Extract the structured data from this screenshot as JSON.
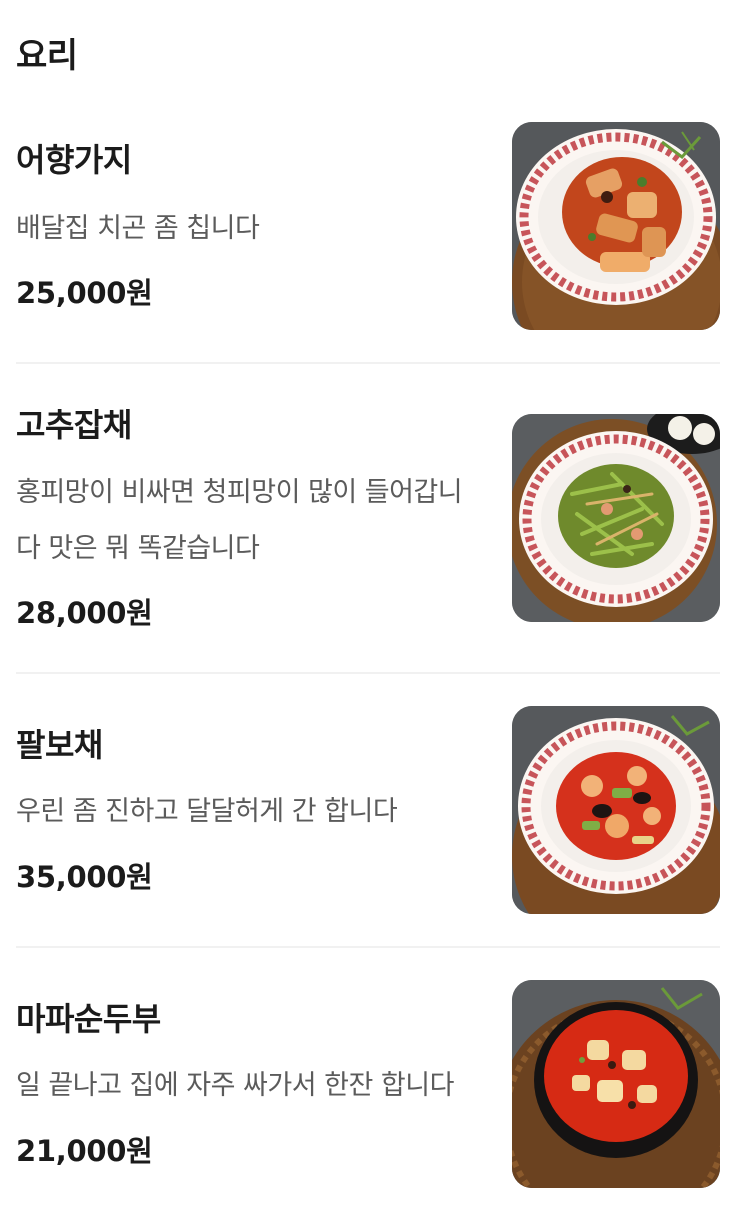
{
  "section": {
    "title": "요리"
  },
  "items": [
    {
      "name": "어향가지",
      "description": "배달집 치곤 좀 칩니다",
      "price": "25,000원",
      "photo": "braised-eggplant-dish-photo",
      "sauce_color": "#c2461c"
    },
    {
      "name": "고추잡채",
      "description": "홍피망이 비싸면 청피망이 많이 들어갑니다 맛은 뭐 똑같습니다",
      "price": "28,000원",
      "photo": "pepper-japchae-dish-photo",
      "sauce_color": "#6f8a2c"
    },
    {
      "name": "팔보채",
      "description": "우린 좀 진하고 달달허게 간 합니다",
      "price": "35,000원",
      "photo": "seafood-palbochae-dish-photo",
      "sauce_color": "#d5311c"
    },
    {
      "name": "마파순두부",
      "description": "일 끝나고 집에 자주 싸가서 한잔 합니다",
      "price": "21,000원",
      "photo": "mapo-soft-tofu-dish-photo",
      "sauce_color": "#d62a14"
    }
  ]
}
